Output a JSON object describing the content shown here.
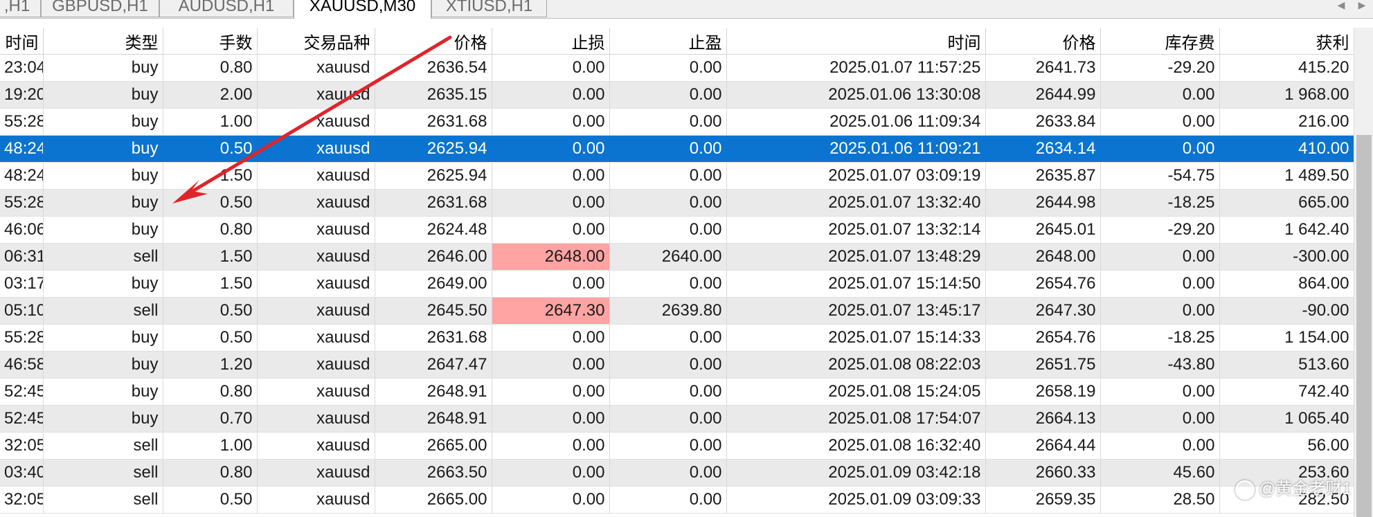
{
  "tabs": [
    {
      "label": ",H1",
      "active": false
    },
    {
      "label": "GBPUSD,H1",
      "active": false
    },
    {
      "label": "AUDUSD,H1",
      "active": false
    },
    {
      "label": "XAUUSD,M30",
      "active": true
    },
    {
      "label": "XTIUSD,H1",
      "active": false
    }
  ],
  "tab_scroll": {
    "left_glyph": "◀",
    "right_glyph": "▶"
  },
  "table": {
    "columns": [
      "时间",
      "类型",
      "手数",
      "交易品种",
      "价格",
      "止损",
      "止盈",
      "时间",
      "价格",
      "库存费",
      "获利"
    ],
    "rows": [
      [
        "23:04",
        "buy",
        "0.80",
        "xauusd",
        "2636.54",
        "0.00",
        "0.00",
        "2025.01.07 11:57:25",
        "2641.73",
        "-29.20",
        "415.20"
      ],
      [
        "19:20",
        "buy",
        "2.00",
        "xauusd",
        "2635.15",
        "0.00",
        "0.00",
        "2025.01.06 13:30:08",
        "2644.99",
        "0.00",
        "1 968.00"
      ],
      [
        "55:28",
        "buy",
        "1.00",
        "xauusd",
        "2631.68",
        "0.00",
        "0.00",
        "2025.01.06 11:09:34",
        "2633.84",
        "0.00",
        "216.00"
      ],
      [
        "48:24",
        "buy",
        "0.50",
        "xauusd",
        "2625.94",
        "0.00",
        "0.00",
        "2025.01.06 11:09:21",
        "2634.14",
        "0.00",
        "410.00"
      ],
      [
        "48:24",
        "buy",
        "1.50",
        "xauusd",
        "2625.94",
        "0.00",
        "0.00",
        "2025.01.07 03:09:19",
        "2635.87",
        "-54.75",
        "1 489.50"
      ],
      [
        "55:28",
        "buy",
        "0.50",
        "xauusd",
        "2631.68",
        "0.00",
        "0.00",
        "2025.01.07 13:32:40",
        "2644.98",
        "-18.25",
        "665.00"
      ],
      [
        "46:06",
        "buy",
        "0.80",
        "xauusd",
        "2624.48",
        "0.00",
        "0.00",
        "2025.01.07 13:32:14",
        "2645.01",
        "-29.20",
        "1 642.40"
      ],
      [
        "06:31",
        "sell",
        "1.50",
        "xauusd",
        "2646.00",
        "2648.00",
        "2640.00",
        "2025.01.07 13:48:29",
        "2648.00",
        "0.00",
        "-300.00"
      ],
      [
        "03:17",
        "buy",
        "1.50",
        "xauusd",
        "2649.00",
        "0.00",
        "0.00",
        "2025.01.07 15:14:50",
        "2654.76",
        "0.00",
        "864.00"
      ],
      [
        "05:10",
        "sell",
        "0.50",
        "xauusd",
        "2645.50",
        "2647.30",
        "2639.80",
        "2025.01.07 13:45:17",
        "2647.30",
        "0.00",
        "-90.00"
      ],
      [
        "55:28",
        "buy",
        "0.50",
        "xauusd",
        "2631.68",
        "0.00",
        "0.00",
        "2025.01.07 15:14:33",
        "2654.76",
        "-18.25",
        "1 154.00"
      ],
      [
        "46:58",
        "buy",
        "1.20",
        "xauusd",
        "2647.47",
        "0.00",
        "0.00",
        "2025.01.08 08:22:03",
        "2651.75",
        "-43.80",
        "513.60"
      ],
      [
        "52:45",
        "buy",
        "0.80",
        "xauusd",
        "2648.91",
        "0.00",
        "0.00",
        "2025.01.08 15:24:05",
        "2658.19",
        "0.00",
        "742.40"
      ],
      [
        "52:45",
        "buy",
        "0.70",
        "xauusd",
        "2648.91",
        "0.00",
        "0.00",
        "2025.01.08 17:54:07",
        "2664.13",
        "0.00",
        "1 065.40"
      ],
      [
        "32:05",
        "sell",
        "1.00",
        "xauusd",
        "2665.00",
        "0.00",
        "0.00",
        "2025.01.08 16:32:40",
        "2664.44",
        "0.00",
        "56.00"
      ],
      [
        "03:40",
        "sell",
        "0.80",
        "xauusd",
        "2663.50",
        "0.00",
        "0.00",
        "2025.01.09 03:42:18",
        "2660.33",
        "45.60",
        "253.60"
      ],
      [
        "32:05",
        "sell",
        "0.50",
        "xauusd",
        "2665.00",
        "0.00",
        "0.00",
        "2025.01.09 03:09:33",
        "2659.35",
        "28.50",
        "282.50"
      ]
    ],
    "selected_row": 3,
    "stop_loss_hit_rows": [
      7,
      9
    ]
  },
  "watermark": {
    "text": "@黄金老财1"
  },
  "colors": {
    "selection": "#0a74d0",
    "stop_loss_hit": "#ffa3a3",
    "arrow": "#e0242a",
    "stripe": "#eaeaea"
  }
}
